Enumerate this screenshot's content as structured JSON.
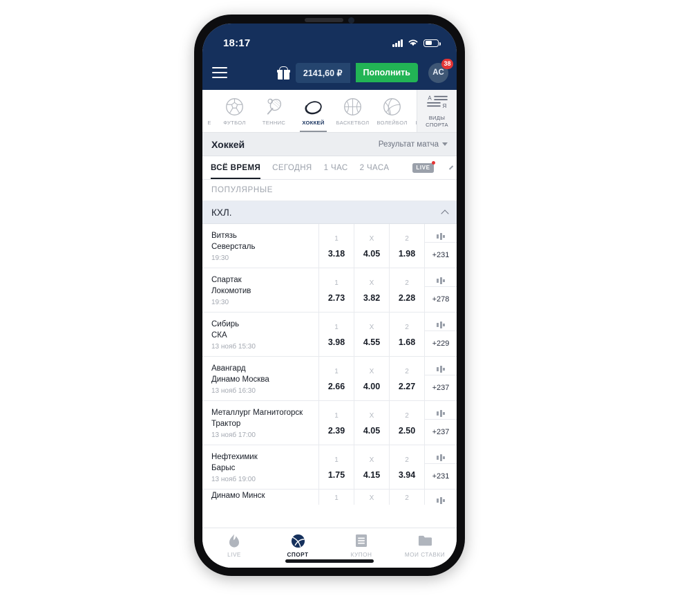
{
  "status_bar": {
    "time": "18:17",
    "signal_icon": "cellular-signal-icon",
    "wifi_icon": "wifi-icon",
    "battery_icon": "battery-icon"
  },
  "app_bar": {
    "menu_icon": "hamburger-menu-icon",
    "gift_icon": "gift-icon",
    "balance": "2141,60 ₽",
    "topup_label": "Пополнить",
    "avatar_initials": "AC",
    "notification_count": "38",
    "bg_color": "#15305c",
    "accent_green": "#22b455",
    "badge_color": "#e43535"
  },
  "sports": [
    {
      "label": "Е",
      "icon": "sport-partial-icon",
      "active": false,
      "partial": true
    },
    {
      "label": "ФУТБОЛ",
      "icon": "soccer-ball-icon",
      "active": false,
      "partial": false
    },
    {
      "label": "ТЕННИС",
      "icon": "tennis-racket-icon",
      "active": false,
      "partial": false
    },
    {
      "label": "ХОККЕЙ",
      "icon": "hockey-puck-icon",
      "active": true,
      "partial": false
    },
    {
      "label": "БАСКЕТБОЛ",
      "icon": "basketball-icon",
      "active": false,
      "partial": false
    },
    {
      "label": "ВОЛЕЙБОЛ",
      "icon": "volleyball-icon",
      "active": false,
      "partial": false
    },
    {
      "label": "К",
      "icon": "sport-partial-icon",
      "active": false,
      "partial": true
    }
  ],
  "all_sports": {
    "icon": "sort-alphabetical-icon",
    "line1": "ВИДЫ",
    "line2": "СПОРТА",
    "glyph_top": "A",
    "glyph_bottom": "Я"
  },
  "section": {
    "title": "Хоккей",
    "market_selector": "Результат матча",
    "caret_icon": "chevron-down-icon"
  },
  "time_tabs": [
    {
      "label": "ВСЁ ВРЕМЯ",
      "active": true
    },
    {
      "label": "СЕГОДНЯ",
      "active": false
    },
    {
      "label": "1 ЧАС",
      "active": false
    },
    {
      "label": "2 ЧАСА",
      "active": false
    }
  ],
  "live_badge": {
    "label": "LIVE",
    "arrow_icon": "chevron-right-icon"
  },
  "popular_label": "ПОПУЛЯРНЫЕ",
  "league": {
    "name": "КХЛ.",
    "collapse_icon": "chevron-up-icon"
  },
  "odds_keys": {
    "home": "1",
    "draw": "X",
    "away": "2"
  },
  "more_icon": "bar-chart-icon",
  "matches": [
    {
      "home": "Витязь",
      "away": "Северсталь",
      "time": "19:30",
      "o1": "3.18",
      "ox": "4.05",
      "o2": "1.98",
      "more": "+231"
    },
    {
      "home": "Спартак",
      "away": "Локомотив",
      "time": "19:30",
      "o1": "2.73",
      "ox": "3.82",
      "o2": "2.28",
      "more": "+278"
    },
    {
      "home": "Сибирь",
      "away": "СКА",
      "time": "13 нояб 15:30",
      "o1": "3.98",
      "ox": "4.55",
      "o2": "1.68",
      "more": "+229"
    },
    {
      "home": "Авангард",
      "away": "Динамо Москва",
      "time": "13 нояб 16:30",
      "o1": "2.66",
      "ox": "4.00",
      "o2": "2.27",
      "more": "+237"
    },
    {
      "home": "Металлург Магнитогорск",
      "away": "Трактор",
      "time": "13 нояб 17:00",
      "o1": "2.39",
      "ox": "4.05",
      "o2": "2.50",
      "more": "+237"
    },
    {
      "home": "Нефтехимик",
      "away": "Барыс",
      "time": "13 нояб 19:00",
      "o1": "1.75",
      "ox": "4.15",
      "o2": "3.94",
      "more": "+231"
    }
  ],
  "partial_match": {
    "home": "Динамо Минск"
  },
  "bottom_nav": [
    {
      "label": "LIVE",
      "icon": "flame-icon",
      "active": false
    },
    {
      "label": "СПОРТ",
      "icon": "sport-ball-icon",
      "active": true
    },
    {
      "label": "КУПОН",
      "icon": "coupon-lines-icon",
      "active": false
    },
    {
      "label": "МОИ СТАВКИ",
      "icon": "folder-icon",
      "active": false
    }
  ]
}
